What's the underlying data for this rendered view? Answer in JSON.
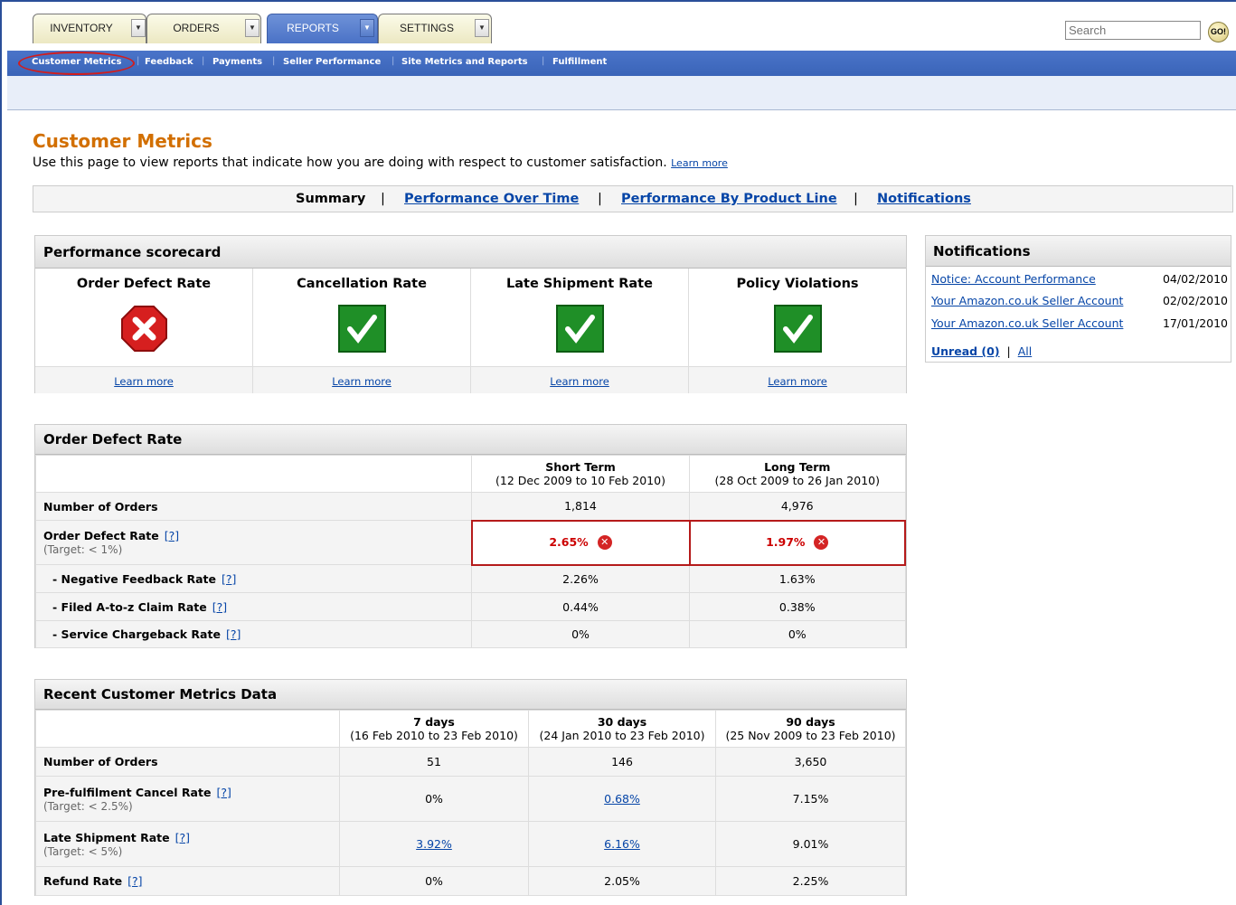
{
  "tabs": [
    {
      "label": "INVENTORY",
      "active": false
    },
    {
      "label": "ORDERS",
      "active": false
    },
    {
      "label": "REPORTS",
      "active": true
    },
    {
      "label": "SETTINGS",
      "active": false
    }
  ],
  "search": {
    "placeholder": "Search",
    "go_label": "GO!"
  },
  "subnav": [
    "Customer Metrics",
    "Feedback",
    "Payments",
    "Seller Performance",
    "Site Metrics and Reports",
    "Fulfillment"
  ],
  "page": {
    "title": "Customer Metrics",
    "description": "Use this page to view reports that indicate how you are doing with respect to customer satisfaction.",
    "learn_more": "Learn more"
  },
  "subtabs": {
    "summary": "Summary",
    "over_time": "Performance Over Time",
    "by_product": "Performance By Product Line",
    "notifications": "Notifications"
  },
  "scorecard": {
    "title": "Performance scorecard",
    "items": [
      {
        "label": "Order Defect Rate",
        "status": "fail",
        "learn": "Learn more"
      },
      {
        "label": "Cancellation Rate",
        "status": "pass",
        "learn": "Learn more"
      },
      {
        "label": "Late Shipment Rate",
        "status": "pass",
        "learn": "Learn more"
      },
      {
        "label": "Policy Violations",
        "status": "pass",
        "learn": "Learn more"
      }
    ]
  },
  "odr": {
    "title": "Order Defect Rate",
    "short_term": "Short Term",
    "short_range": "(12 Dec 2009 to 10 Feb 2010)",
    "long_term": "Long Term",
    "long_range": "(28 Oct 2009 to 26 Jan 2010)",
    "help": "[?]",
    "rows": [
      {
        "label": "Number of Orders",
        "target": "",
        "short": "1,814",
        "long": "4,976"
      },
      {
        "label": "Order Defect Rate",
        "target": "(Target: < 1%)",
        "short": "2.65%",
        "long": "1.97%"
      },
      {
        "label": "- Negative Feedback Rate",
        "target": "",
        "short": "2.26%",
        "long": "1.63%"
      },
      {
        "label": "- Filed A-to-z Claim Rate",
        "target": "",
        "short": "0.44%",
        "long": "0.38%"
      },
      {
        "label": "- Service Chargeback Rate",
        "target": "",
        "short": "0%",
        "long": "0%"
      }
    ]
  },
  "recent": {
    "title": "Recent Customer Metrics Data",
    "cols": [
      {
        "label": "7 days",
        "range": "(16 Feb 2010 to 23 Feb 2010)"
      },
      {
        "label": "30 days",
        "range": "(24 Jan 2010 to 23 Feb 2010)"
      },
      {
        "label": "90 days",
        "range": "(25 Nov 2009 to 23 Feb 2010)"
      }
    ],
    "rows": [
      {
        "label": "Number of Orders",
        "target": "",
        "v": [
          "51",
          "146",
          "3,650"
        ]
      },
      {
        "label": "Pre-fulfilment Cancel Rate",
        "target": "(Target: < 2.5%)",
        "v": [
          "0%",
          "0.68%",
          "7.15%"
        ]
      },
      {
        "label": "Late Shipment Rate",
        "target": "(Target: < 5%)",
        "v": [
          "3.92%",
          "6.16%",
          "9.01%"
        ]
      },
      {
        "label": "Refund Rate",
        "target": "",
        "v": [
          "0%",
          "2.05%",
          "2.25%"
        ]
      }
    ]
  },
  "notifications": {
    "title": "Notifications",
    "items": [
      {
        "text": "Notice: Account Performance",
        "date": "04/02/2010"
      },
      {
        "text": "Your Amazon.co.uk Seller Account",
        "date": "02/02/2010"
      },
      {
        "text": "Your Amazon.co.uk Seller Account",
        "date": "17/01/2010"
      }
    ],
    "unread": "Unread (0)",
    "all": "All"
  },
  "colors": {
    "accent": "#d26f00",
    "nav": "#3a64b8",
    "link": "#0645a7",
    "error": "#d42424",
    "ok": "#1f8f27"
  }
}
